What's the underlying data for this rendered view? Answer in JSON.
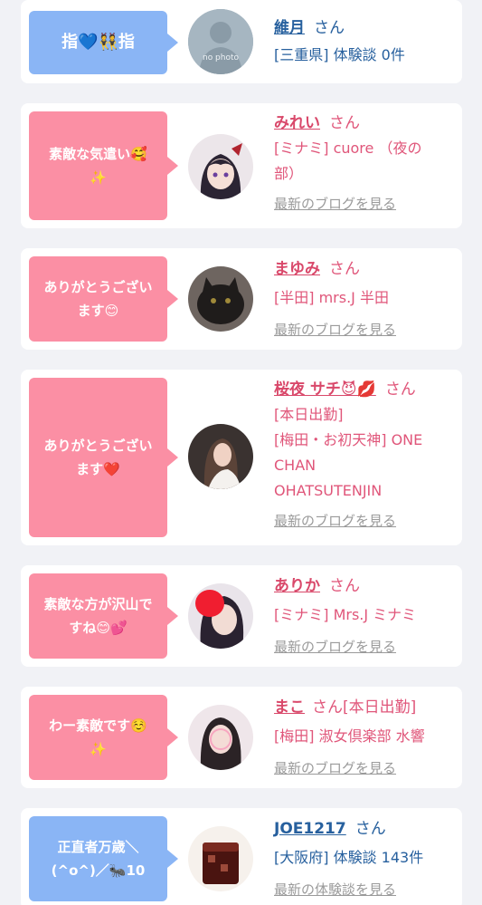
{
  "entries": [
    {
      "bubble": "指💙👯指",
      "name": "維月",
      "san": "さん",
      "detail": "[三重県] 体験談 0件",
      "link": "",
      "avatar_text": "no photo",
      "theme": "blue"
    },
    {
      "bubble": "素敵な気遣い🥰\n✨",
      "name": "みれい",
      "san": "さん",
      "detail": "[ミナミ] cuore （夜の\n部）",
      "link": "最新のブログを見る",
      "theme": "pink"
    },
    {
      "bubble": "ありがとうござい\nます😊",
      "name": "まゆみ",
      "san": "さん",
      "detail": "[半田] mrs.J 半田",
      "link": "最新のブログを見る",
      "theme": "pink"
    },
    {
      "bubble": "ありがとうござい\nます❤️",
      "name": "桜夜 サチ😈💋",
      "san": "さん",
      "detail": "[本日出勤]\n[梅田・お初天神] ONE\nCHAN\nOHATSUTENJIN",
      "link": "最新のブログを見る",
      "theme": "pink"
    },
    {
      "bubble": "素敵な方が沢山で\nすね😊💕",
      "name": "ありか",
      "san": "さん",
      "detail": "[ミナミ] Mrs.J ミナミ",
      "link": "最新のブログを見る",
      "theme": "pink"
    },
    {
      "bubble": "わー素敵です☺️\n✨",
      "name": "まこ",
      "san": "さん[本日出勤]",
      "detail": "[梅田] 淑女倶楽部 水響",
      "link": "最新のブログを見る",
      "theme": "pink"
    },
    {
      "bubble": "正直者万歳＼\n(^o^)／🐜10",
      "name": "JOE1217",
      "san": "さん",
      "detail": "[大阪府] 体験談 143件",
      "link": "最新の体験談を見る",
      "theme": "blue"
    }
  ]
}
